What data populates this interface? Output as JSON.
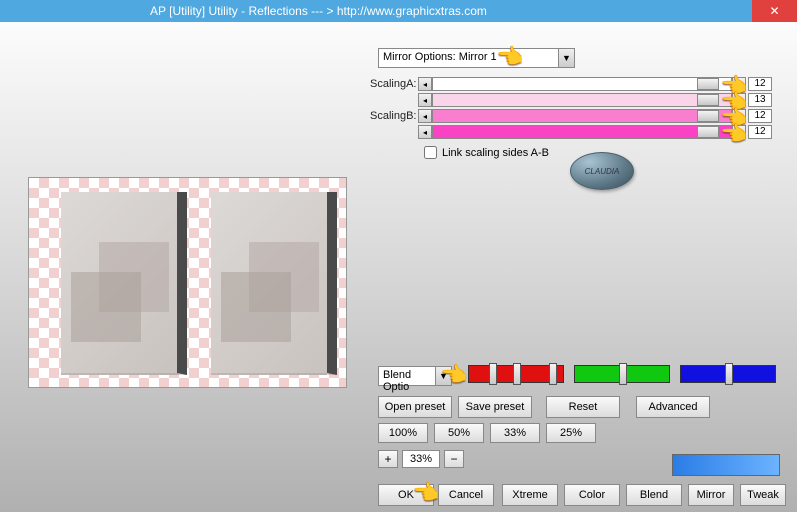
{
  "title": "AP [Utility]  Utility - Reflections    --- > http://www.graphicxtras.com",
  "mirror_options": {
    "label": "Mirror Options: Mirror 1"
  },
  "scaling": {
    "a_label": "ScalingA:",
    "b_label": "ScalingB:",
    "rows": [
      {
        "value": "12",
        "fill": "#ffffff"
      },
      {
        "value": "13",
        "fill": "#fad4e9"
      },
      {
        "value": "12",
        "fill": "#fa7ed0"
      },
      {
        "value": "12",
        "fill": "#fa42c4"
      }
    ],
    "link_label": "Link scaling sides A-B"
  },
  "badge_text": "CLAUDIA",
  "blend_options_label": "Blend Optio",
  "color_sliders": {
    "red": "#e01010",
    "green": "#10c810",
    "blue": "#1010e0"
  },
  "buttons": {
    "open_preset": "Open preset",
    "save_preset": "Save preset",
    "reset": "Reset",
    "advanced": "Advanced",
    "p100": "100%",
    "p50": "50%",
    "p33": "33%",
    "p25": "25%",
    "ok": "OK",
    "cancel": "Cancel",
    "xtreme": "Xtreme",
    "color": "Color",
    "blend": "Blend",
    "mirror": "Mirror",
    "tweak": "Tweak"
  },
  "stepper": {
    "value": "33%",
    "plus": "+",
    "minus": "−"
  }
}
